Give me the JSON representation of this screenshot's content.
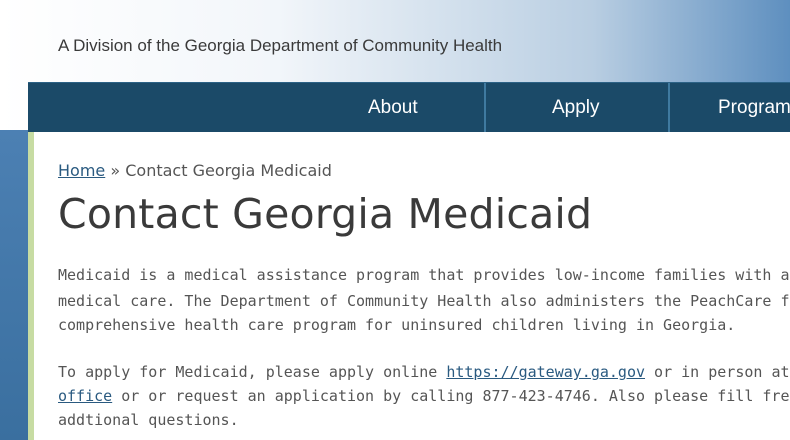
{
  "header": {
    "tagline": "A Division of the Georgia Department of Community Health"
  },
  "nav": {
    "items": [
      {
        "label": "About"
      },
      {
        "label": "Apply"
      },
      {
        "label": "Program"
      }
    ]
  },
  "breadcrumb": {
    "home": "Home",
    "separator": "»",
    "current": "Contact Georgia Medicaid"
  },
  "page": {
    "title": "Contact Georgia Medicaid",
    "p1": {
      "line1": "Medicaid is a medical assistance program that provides low-income families with acce",
      "line2": "medical care. The Department of Community Health also administers the PeachCare f",
      "line3": "comprehensive health care program for uninsured children living in Georgia."
    },
    "p2": {
      "line1_a": "To apply for Medicaid, please apply online ",
      "link_gateway": "https://gateway.ga.gov",
      "line1_b": " or in person at you",
      "link_office": "office",
      "line2_b": " or or request an application by calling 877-423-4746. Also please fill free to ser",
      "line3": "addtional questions."
    }
  },
  "colors": {
    "nav_bg": "#1b4a68",
    "link": "#2a5a80",
    "content_border": "#c7dca3"
  }
}
